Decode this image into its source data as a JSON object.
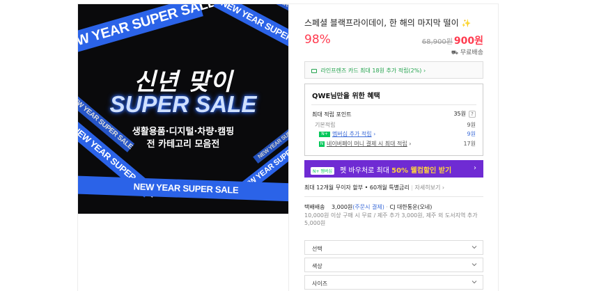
{
  "banner": {
    "ribbon_text_1": "NEW YEAR SUPER SALE",
    "ribbon_text_2": "NEW YEAR SUPER SALE",
    "ribbon_text_3": "NEW YEAR SUPER SALE",
    "ribbon_text_4": "NEW YEAR SUPER SALE",
    "ribbon_text_5": "NEW YEAR SUPER SALE",
    "ribbon_text_6": "NEW YEAR SUPER SALE",
    "ribbon_text_7": "NEW YEAR SUPER SALE",
    "ribbon_bottom": "NEW YEAR SUPER SALE",
    "headline": "신년 맞이",
    "sale_title": "SUPER SALE",
    "sub_line_1": "생활용품·디지털·차량·캠핑",
    "sub_line_2": "전 카테고리 모음전"
  },
  "product": {
    "title": "스페셜 블랙프라이데이, 한 해의 마지막 떨이",
    "title_icon": "sparkle-icon",
    "discount": "98%",
    "original_price": "68,900원",
    "sale_price": "900원",
    "shipping": "무료배송"
  },
  "card_offer": {
    "text": "라인프렌즈 카드 최대 18원 추가 적립(2%)"
  },
  "benefit": {
    "heading": "QWE님만을 위한 혜택",
    "max_points_label": "최대 적립 포인트",
    "max_points_value": "35원",
    "basic_label": "기본적립",
    "basic_value": "9원",
    "membership_badge": "N+",
    "membership_label": "멤버십 추가 적립",
    "membership_value": "9원",
    "npay_badge": "N",
    "npay_label": "네이버페이 머니 결제 시 최대 적립",
    "npay_value": "17원"
  },
  "promo": {
    "badge": "N+ 멤버십",
    "text_prefix": "펫 바우처로 최대 ",
    "text_highlight": "50% 웰컴할인 받기"
  },
  "installment": {
    "text": "최대 12개월 무이자 할부 • 60개월 특별금리",
    "more": "자세히보기"
  },
  "delivery": {
    "label": "택배배송",
    "fee": "3,000원",
    "paid_note": "(주문시 결제)",
    "carrier": "CJ 대한통운(오네)",
    "note": "10,000원 이상 구매 시 무료 / 제주 추가 3,000원, 제주 외 도서지역 추가 5,000원"
  },
  "options": [
    {
      "label": "선택"
    },
    {
      "label": "색상"
    },
    {
      "label": "사이즈"
    }
  ],
  "colors": {
    "accent_red": "#ff3b4f",
    "promo_purple": "#6f2bd3",
    "npay_green": "#03c75a",
    "ribbon_blue": "#2b63e8"
  }
}
